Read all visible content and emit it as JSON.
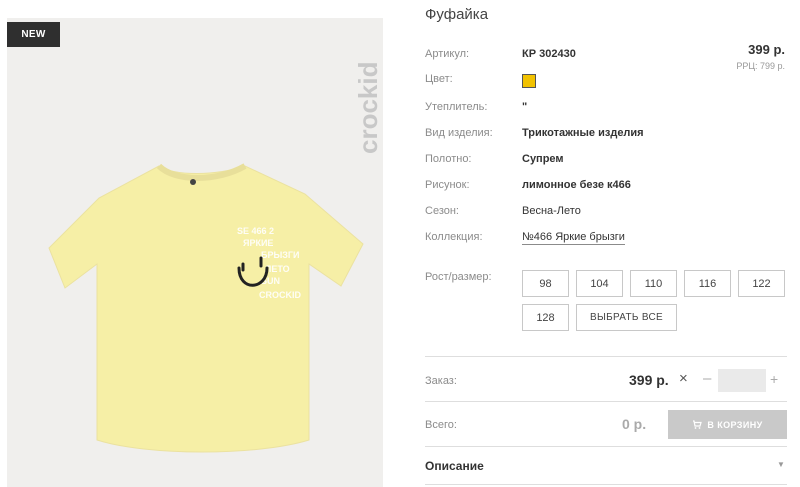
{
  "badge": {
    "label": "NEW"
  },
  "brand": {
    "logo_text": "crockid"
  },
  "product": {
    "title": "Фуфайка",
    "price": "399 р.",
    "rrp": "РРЦ: 799 р."
  },
  "attributes": [
    {
      "label": "Артикул:",
      "value": "КР 302430"
    },
    {
      "label": "Цвет:",
      "value": ""
    },
    {
      "label": "Утеплитель:",
      "value": "\""
    },
    {
      "label": "Вид изделия:",
      "value": "Трикотажные изделия"
    },
    {
      "label": "Полотно:",
      "value": "Супрем"
    },
    {
      "label": "Рисунок:",
      "value": "лимонное безе к466"
    },
    {
      "label": "Сезон:",
      "value": "Весна-Лето"
    },
    {
      "label": "Коллекция:",
      "value": "№466 Яркие брызги"
    }
  ],
  "colors": {
    "swatch": "#f2c200"
  },
  "sizes": {
    "label": "Рост/размер:",
    "options": [
      "98",
      "104",
      "110",
      "116",
      "122",
      "128"
    ],
    "select_all": "ВЫБРАТЬ ВСЕ"
  },
  "order": {
    "label": "Заказ:",
    "price": "399 р.",
    "times": "×",
    "minus": "–",
    "plus": "+",
    "quantity": ""
  },
  "total": {
    "label": "Всего:",
    "value": "0 р.",
    "cart_button": "В КОРЗИНУ"
  },
  "description": {
    "title": "Описание"
  }
}
